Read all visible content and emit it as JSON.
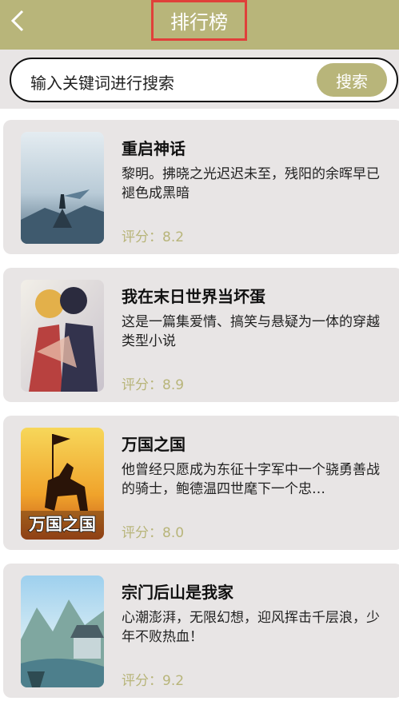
{
  "header": {
    "title": "排行榜",
    "back_icon": "chevron-left-icon"
  },
  "search": {
    "placeholder": "输入关键词进行搜索",
    "button_label": "搜索"
  },
  "books": [
    {
      "title": "重启神话",
      "desc": "黎明。拂晓之光迟迟未至，残阳的余晖早已褪色成黑暗",
      "rating": "评分：8.2"
    },
    {
      "title": "我在末日世界当坏蛋",
      "desc": "这是一篇集爱情、搞笑与悬疑为一体的穿越类型小说",
      "rating": "评分：8.9"
    },
    {
      "title": "万国之国",
      "desc": "他曾经只愿成为东征十字军中一个骁勇善战的骑士，鲍德温四世麾下一个忠…",
      "rating": "评分：8.0",
      "cover_text": "万国之国"
    },
    {
      "title": "宗门后山是我家",
      "desc": "心潮澎湃，无限幻想，迎风挥击千层浪，少年不败热血！",
      "rating": "评分：9.2"
    }
  ],
  "colors": {
    "accent": "#b8b57a",
    "highlight_border": "#e0403a",
    "card_bg": "#e8e5e5"
  }
}
